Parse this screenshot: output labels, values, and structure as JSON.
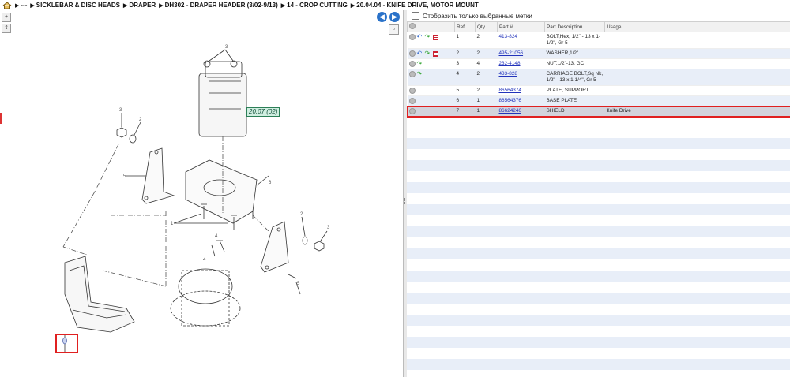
{
  "breadcrumb": {
    "items": [
      {
        "label": "---",
        "dots": true
      },
      {
        "label": "SICKLEBAR & DISC HEADS"
      },
      {
        "label": "DRAPER"
      },
      {
        "label": "DH302 - DRAPER HEADER (3/02-9/13)"
      },
      {
        "label": "14 - CROP CUTTING"
      },
      {
        "label": "20.04.04 - KNIFE DRIVE, MOTOR MOUNT"
      }
    ]
  },
  "drawing": {
    "callout_label": "20.07 (02)"
  },
  "filter": {
    "label": "Отобразить только выбранные метки"
  },
  "table": {
    "columns": [
      "",
      "Ref",
      "Qty",
      "Part #",
      "Part Description",
      "Usage"
    ],
    "rows": [
      {
        "ref": "1",
        "qty": "2",
        "part": "413-824",
        "desc": "BOLT,Hex, 1/2\" - 13 x 1-1/2\", Gr 5",
        "usage": "",
        "icons": [
          "add",
          "undo",
          "redo",
          "list"
        ]
      },
      {
        "ref": "2",
        "qty": "2",
        "part": "495-21056",
        "desc": "WASHER,1/2\"",
        "usage": "",
        "icons": [
          "add",
          "undo",
          "redo",
          "list"
        ]
      },
      {
        "ref": "3",
        "qty": "4",
        "part": "232-4148",
        "desc": "NUT,1/2\"-13, GC",
        "usage": "",
        "icons": [
          "add",
          "redo"
        ]
      },
      {
        "ref": "4",
        "qty": "2",
        "part": "433-828",
        "desc": "CARRIAGE BOLT,Sq Nk, 1/2\" - 13 x 1 1/4\", Gr 5",
        "usage": "",
        "icons": [
          "add",
          "redo"
        ]
      },
      {
        "ref": "5",
        "qty": "2",
        "part": "86564374",
        "desc": "PLATE, SUPPORT",
        "usage": "",
        "icons": [
          "add"
        ]
      },
      {
        "ref": "6",
        "qty": "1",
        "part": "86564376",
        "desc": "BASE PLATE",
        "usage": "",
        "icons": [
          "add"
        ]
      },
      {
        "ref": "7",
        "qty": "1",
        "part": "86624246",
        "desc": "SHIELD",
        "usage": "Knife Drive",
        "icons": [
          "add"
        ],
        "selected": true
      }
    ]
  },
  "colors": {
    "accent_link": "#2233bb",
    "highlight": "#e02020",
    "callout_bg": "#cfeee0"
  }
}
